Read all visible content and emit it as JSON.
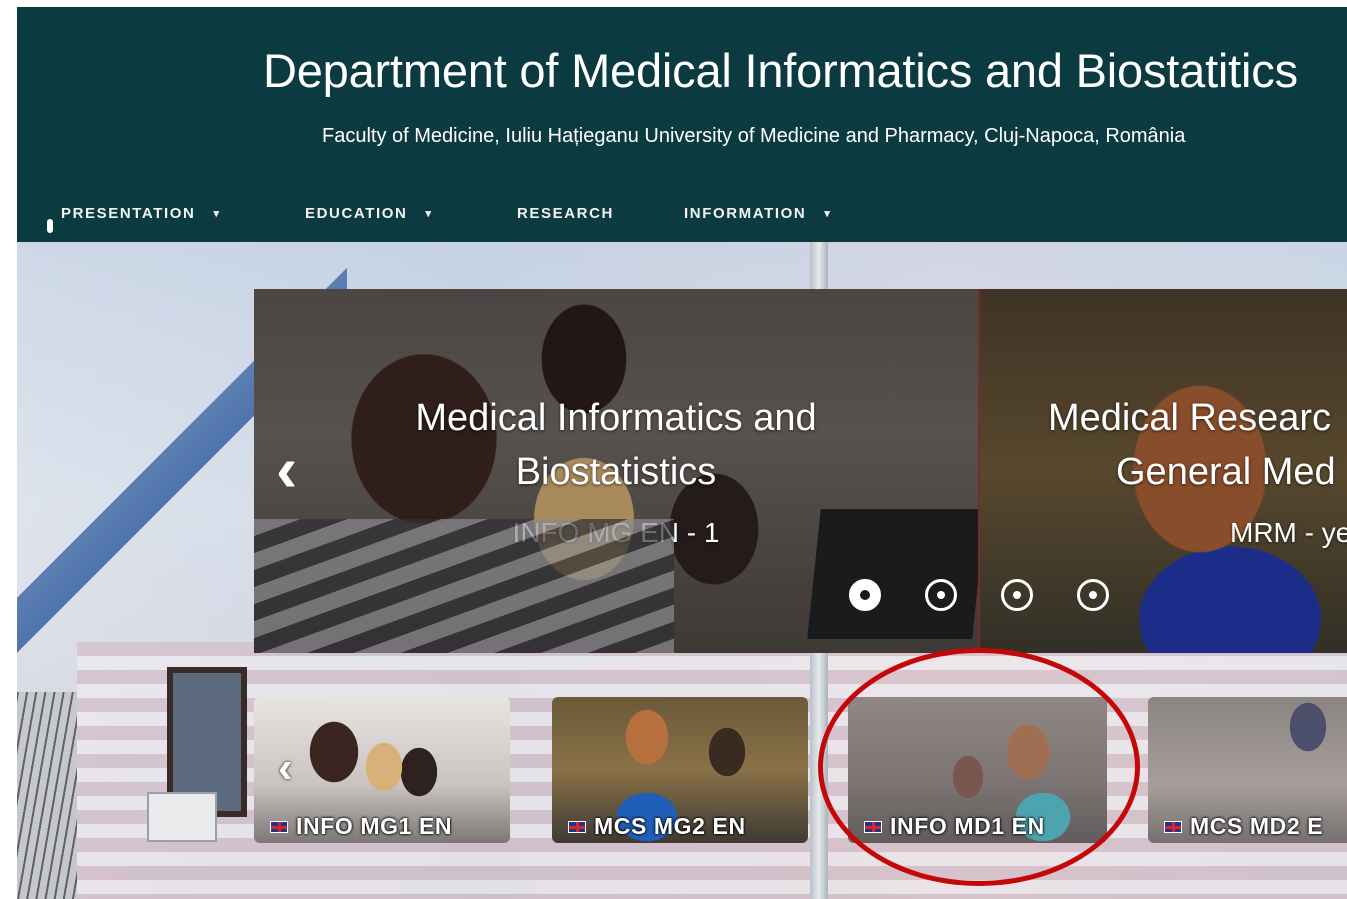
{
  "header": {
    "title": "Department of Medical Informatics and Biostatitics",
    "subtitle": "Faculty of Medicine, Iuliu Hațieganu University of Medicine and Pharmacy, Cluj-Napoca, România"
  },
  "nav": {
    "items": [
      {
        "label": "PRESENTATION",
        "dropdown": true
      },
      {
        "label": "EDUCATION",
        "dropdown": true
      },
      {
        "label": "RESEARCH",
        "dropdown": false
      },
      {
        "label": "INFORMATION",
        "dropdown": true
      }
    ],
    "chevron": "▾"
  },
  "carousel": {
    "prev_arrow": "‹",
    "slides": [
      {
        "title_line1": "Medical Informatics and",
        "title_line2": "Biostatistics",
        "subtitle": "INFO MG EN - 1"
      },
      {
        "title_line1": "Medical Researc",
        "title_line2": "General Med",
        "subtitle": "MRM - ye"
      }
    ],
    "dots_count": 4,
    "active_dot": 0
  },
  "thumbnails": {
    "prev_arrow": "‹",
    "items": [
      {
        "label": "INFO MG1 EN"
      },
      {
        "label": "MCS MG2 EN"
      },
      {
        "label": "INFO MD1 EN"
      },
      {
        "label": "MCS MD2 E"
      }
    ]
  },
  "annotation": {
    "color": "#c4080a",
    "target": "INFO MD1 EN"
  },
  "colors": {
    "header_bg": "#0b3a41",
    "text": "#ffffff"
  }
}
